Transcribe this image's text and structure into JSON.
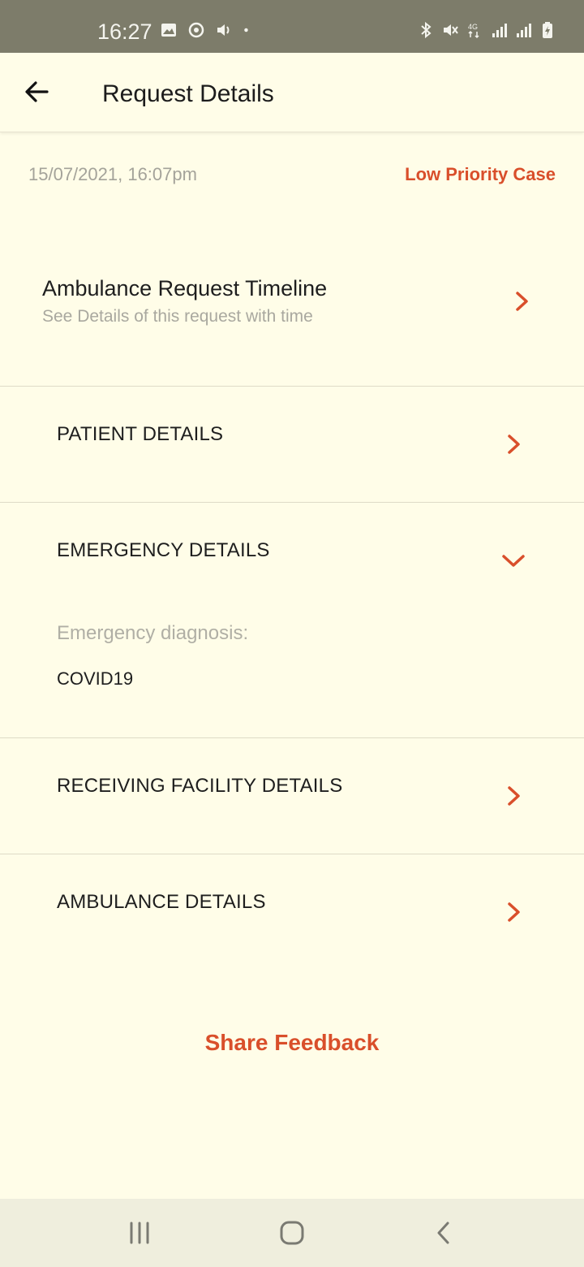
{
  "status_bar": {
    "time": "16:27",
    "left_icons": [
      "image-icon",
      "sync-icon",
      "volume-icon",
      "dot-icon"
    ],
    "right_icons": [
      "bluetooth-icon",
      "mute-icon",
      "4g-icon",
      "signal-icon",
      "signal-icon",
      "battery-charging-icon"
    ],
    "network_label": "4G"
  },
  "app_bar": {
    "back_icon": "arrow-left-icon",
    "title": "Request Details"
  },
  "meta": {
    "date": "15/07/2021, 16:07pm",
    "priority": "Low Priority Case"
  },
  "timeline": {
    "title": "Ambulance Request Timeline",
    "subtitle": "See Details of this request with time"
  },
  "sections": [
    {
      "label": "PATIENT DETAILS",
      "expanded": false
    },
    {
      "label": "EMERGENCY DETAILS",
      "expanded": true
    },
    {
      "label": "RECEIVING FACILITY DETAILS",
      "expanded": false
    },
    {
      "label": "AMBULANCE DETAILS",
      "expanded": false
    }
  ],
  "emergency": {
    "diagnosis_label": "Emergency diagnosis:",
    "diagnosis_value": "COVID19"
  },
  "share_feedback": "Share Feedback",
  "nav_bar": {
    "buttons": [
      "recents-icon",
      "home-icon",
      "back-icon"
    ]
  },
  "colors": {
    "accent": "#d94f2b",
    "background": "#fffde8",
    "status_bar": "#7d7c6a",
    "nav_bar": "#efeedd"
  }
}
